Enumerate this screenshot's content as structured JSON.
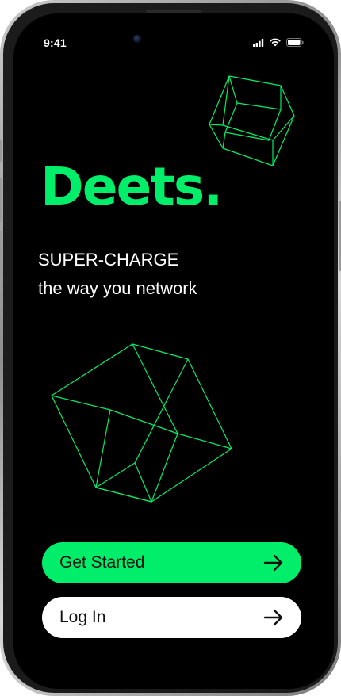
{
  "status_bar": {
    "time": "9:41",
    "icons": [
      "cellular-signal-icon",
      "wifi-icon",
      "battery-icon"
    ]
  },
  "hero": {
    "logo": "Deets.",
    "tagline_line1": "SUPER-CHARGE",
    "tagline_line2": "the way you network"
  },
  "actions": {
    "get_started_label": "Get Started",
    "login_label": "Log In"
  },
  "colors": {
    "brand_green": "#00ee6a",
    "background": "#000000",
    "secondary_button": "#ffffff",
    "text_light": "#ffffff",
    "text_dark": "#111111"
  }
}
